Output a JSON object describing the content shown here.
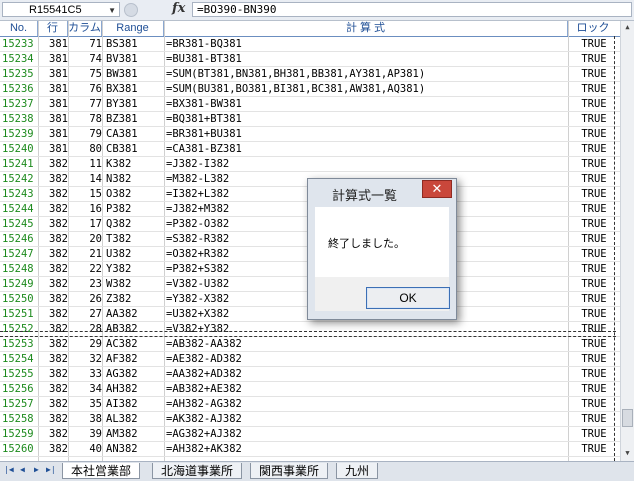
{
  "formula_bar": {
    "name_box": "R15541C5",
    "fx": "fx",
    "formula": "=BO390-BN390"
  },
  "headers": {
    "no": "No.",
    "row": "行",
    "col": "カラム",
    "range": "Range",
    "formula": "計 算 式",
    "lock": "ロック"
  },
  "rows": [
    {
      "no": "15233",
      "r": "381",
      "c": "71",
      "g": "BS381",
      "f": "=BR381-BQ381",
      "l": "TRUE"
    },
    {
      "no": "15234",
      "r": "381",
      "c": "74",
      "g": "BV381",
      "f": "=BU381-BT381",
      "l": "TRUE"
    },
    {
      "no": "15235",
      "r": "381",
      "c": "75",
      "g": "BW381",
      "f": "=SUM(BT381,BN381,BH381,BB381,AY381,AP381)",
      "l": "TRUE"
    },
    {
      "no": "15236",
      "r": "381",
      "c": "76",
      "g": "BX381",
      "f": "=SUM(BU381,BO381,BI381,BC381,AW381,AQ381)",
      "l": "TRUE"
    },
    {
      "no": "15237",
      "r": "381",
      "c": "77",
      "g": "BY381",
      "f": "=BX381-BW381",
      "l": "TRUE"
    },
    {
      "no": "15238",
      "r": "381",
      "c": "78",
      "g": "BZ381",
      "f": "=BQ381+BT381",
      "l": "TRUE"
    },
    {
      "no": "15239",
      "r": "381",
      "c": "79",
      "g": "CA381",
      "f": "=BR381+BU381",
      "l": "TRUE"
    },
    {
      "no": "15240",
      "r": "381",
      "c": "80",
      "g": "CB381",
      "f": "=CA381-BZ381",
      "l": "TRUE"
    },
    {
      "no": "15241",
      "r": "382",
      "c": "11",
      "g": "K382",
      "f": "=J382-I382",
      "l": "TRUE"
    },
    {
      "no": "15242",
      "r": "382",
      "c": "14",
      "g": "N382",
      "f": "=M382-L382",
      "l": "TRUE"
    },
    {
      "no": "15243",
      "r": "382",
      "c": "15",
      "g": "O382",
      "f": "=I382+L382",
      "l": "TRUE"
    },
    {
      "no": "15244",
      "r": "382",
      "c": "16",
      "g": "P382",
      "f": "=J382+M382",
      "l": "TRUE"
    },
    {
      "no": "15245",
      "r": "382",
      "c": "17",
      "g": "Q382",
      "f": "=P382-O382",
      "l": "TRUE"
    },
    {
      "no": "15246",
      "r": "382",
      "c": "20",
      "g": "T382",
      "f": "=S382-R382",
      "l": "TRUE"
    },
    {
      "no": "15247",
      "r": "382",
      "c": "21",
      "g": "U382",
      "f": "=O382+R382",
      "l": "TRUE"
    },
    {
      "no": "15248",
      "r": "382",
      "c": "22",
      "g": "Y382",
      "f": "=P382+S382",
      "l": "TRUE"
    },
    {
      "no": "15249",
      "r": "382",
      "c": "23",
      "g": "W382",
      "f": "=V382-U382",
      "l": "TRUE"
    },
    {
      "no": "15250",
      "r": "382",
      "c": "26",
      "g": "Z382",
      "f": "=Y382-X382",
      "l": "TRUE"
    },
    {
      "no": "15251",
      "r": "382",
      "c": "27",
      "g": "AA382",
      "f": "=U382+X382",
      "l": "TRUE"
    },
    {
      "no": "15252",
      "r": "382",
      "c": "28",
      "g": "AB382",
      "f": "=V382+Y382",
      "l": "TRUE"
    },
    {
      "no": "15253",
      "r": "382",
      "c": "29",
      "g": "AC382",
      "f": "=AB382-AA382",
      "l": "TRUE"
    },
    {
      "no": "15254",
      "r": "382",
      "c": "32",
      "g": "AF382",
      "f": "=AE382-AD382",
      "l": "TRUE"
    },
    {
      "no": "15255",
      "r": "382",
      "c": "33",
      "g": "AG382",
      "f": "=AA382+AD382",
      "l": "TRUE"
    },
    {
      "no": "15256",
      "r": "382",
      "c": "34",
      "g": "AH382",
      "f": "=AB382+AE382",
      "l": "TRUE"
    },
    {
      "no": "15257",
      "r": "382",
      "c": "35",
      "g": "AI382",
      "f": "=AH382-AG382",
      "l": "TRUE"
    },
    {
      "no": "15258",
      "r": "382",
      "c": "38",
      "g": "AL382",
      "f": "=AK382-AJ382",
      "l": "TRUE"
    },
    {
      "no": "15259",
      "r": "382",
      "c": "39",
      "g": "AM382",
      "f": "=AG382+AJ382",
      "l": "TRUE"
    },
    {
      "no": "15260",
      "r": "382",
      "c": "40",
      "g": "AN382",
      "f": "=AH382+AK382",
      "l": "TRUE"
    }
  ],
  "tabs": [
    "本社営業部",
    "北海道事業所",
    "関西事業所",
    "九州"
  ],
  "dialog": {
    "title": "計算式一覧",
    "close": "✕",
    "message": "終了しました。",
    "ok": "OK"
  },
  "colors": {
    "row_number": "#1c8a1c",
    "header_text": "#1f4f96",
    "close_button": "#c9473b"
  }
}
